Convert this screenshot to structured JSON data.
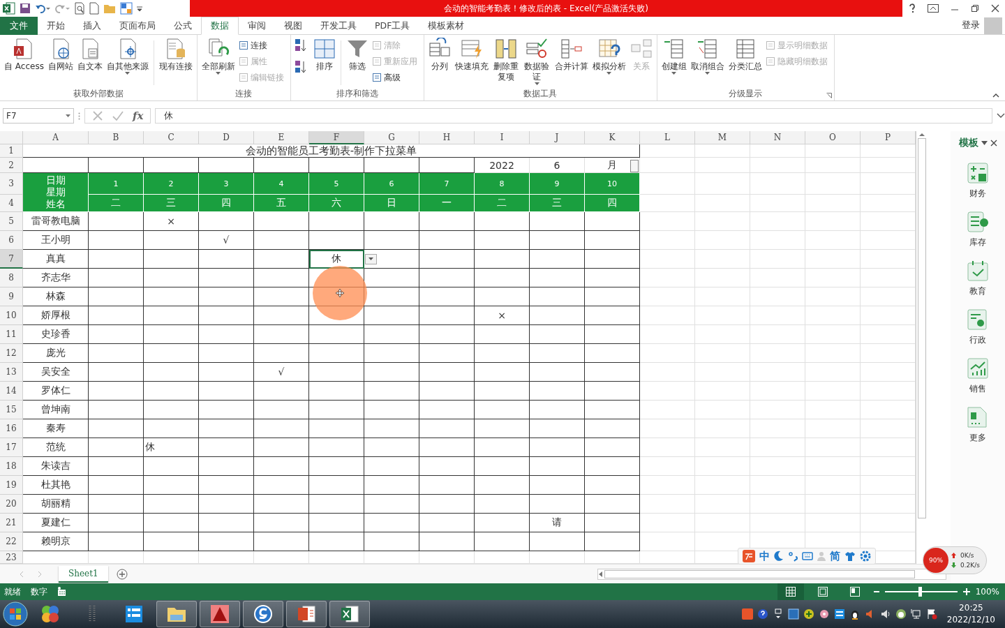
{
  "window": {
    "title": "会动的智能考勤表！修改后的表 - Excel(产品激活失败)",
    "sign_in": "登录"
  },
  "tabs": [
    {
      "label": "文件",
      "kind": "file",
      "selected": false
    },
    {
      "label": "开始",
      "kind": "tab",
      "selected": false
    },
    {
      "label": "插入",
      "kind": "tab",
      "selected": false
    },
    {
      "label": "页面布局",
      "kind": "tab",
      "selected": false
    },
    {
      "label": "公式",
      "kind": "tab",
      "selected": false
    },
    {
      "label": "数据",
      "kind": "tab",
      "selected": true
    },
    {
      "label": "审阅",
      "kind": "tab",
      "selected": false
    },
    {
      "label": "视图",
      "kind": "tab",
      "selected": false
    },
    {
      "label": "开发工具",
      "kind": "tab",
      "selected": false
    },
    {
      "label": "PDF工具",
      "kind": "tab",
      "selected": false
    },
    {
      "label": "模板素材",
      "kind": "tab",
      "selected": false
    }
  ],
  "ribbon": {
    "groups": [
      {
        "label": "获取外部数据",
        "launcher": false,
        "items": [
          {
            "kind": "large",
            "label": "自 Access",
            "dropdown": false,
            "disabled": false
          },
          {
            "kind": "large",
            "label": "自网站",
            "dropdown": false,
            "disabled": false
          },
          {
            "kind": "large",
            "label": "自文本",
            "dropdown": false,
            "disabled": false
          },
          {
            "kind": "large",
            "label": "自其他来源",
            "dropdown": true,
            "disabled": false
          },
          {
            "kind": "separator"
          },
          {
            "kind": "large",
            "label": "现有连接",
            "dropdown": false,
            "disabled": false
          }
        ]
      },
      {
        "label": "连接",
        "launcher": false,
        "items": [
          {
            "kind": "large",
            "label": "全部刷新",
            "dropdown": true,
            "disabled": false
          },
          {
            "kind": "stack",
            "buttons": [
              {
                "label": "连接",
                "disabled": false
              },
              {
                "label": "属性",
                "disabled": true
              },
              {
                "label": "编辑链接",
                "disabled": true
              }
            ]
          }
        ]
      },
      {
        "label": "排序和筛选",
        "launcher": false,
        "items": [
          {
            "kind": "sort-pair"
          },
          {
            "kind": "large",
            "label": "排序",
            "dropdown": false,
            "disabled": false
          },
          {
            "kind": "separator"
          },
          {
            "kind": "large",
            "label": "筛选",
            "dropdown": false,
            "disabled": false
          },
          {
            "kind": "stack",
            "buttons": [
              {
                "label": "清除",
                "disabled": true
              },
              {
                "label": "重新应用",
                "disabled": true
              },
              {
                "label": "高级",
                "disabled": false
              }
            ]
          }
        ]
      },
      {
        "label": "数据工具",
        "launcher": false,
        "items": [
          {
            "kind": "large",
            "label": "分列",
            "dropdown": false,
            "disabled": false
          },
          {
            "kind": "large",
            "label": "快速填充",
            "dropdown": false,
            "disabled": false
          },
          {
            "kind": "large",
            "label": "删除重复项",
            "dropdown": false,
            "disabled": false,
            "wrap": true
          },
          {
            "kind": "large",
            "label": "数据验证",
            "dropdown": true,
            "disabled": false,
            "wrap": true
          },
          {
            "kind": "large",
            "label": "合并计算",
            "dropdown": false,
            "disabled": false
          },
          {
            "kind": "large",
            "label": "模拟分析",
            "dropdown": true,
            "disabled": false
          },
          {
            "kind": "large",
            "label": "关系",
            "dropdown": false,
            "disabled": true
          }
        ]
      },
      {
        "label": "分级显示",
        "launcher": true,
        "items": [
          {
            "kind": "large",
            "label": "创建组",
            "dropdown": true,
            "disabled": false
          },
          {
            "kind": "large",
            "label": "取消组合",
            "dropdown": true,
            "disabled": false
          },
          {
            "kind": "large",
            "label": "分类汇总",
            "dropdown": false,
            "disabled": false
          },
          {
            "kind": "stack",
            "buttons": [
              {
                "label": "显示明细数据",
                "disabled": true
              },
              {
                "label": "隐藏明细数据",
                "disabled": true
              }
            ]
          }
        ]
      }
    ]
  },
  "formula_bar": {
    "name_box": "F7",
    "fx": "fx",
    "value": "休"
  },
  "sheet": {
    "columns": [
      "A",
      "B",
      "C",
      "D",
      "E",
      "F",
      "G",
      "H",
      "I",
      "J",
      "K",
      "L",
      "M",
      "N",
      "O",
      "P"
    ],
    "row_numbers": [
      "1",
      "2",
      "3",
      "4",
      "5",
      "6",
      "7",
      "8",
      "9",
      "10",
      "11",
      "12",
      "13",
      "14",
      "15",
      "16",
      "17",
      "18",
      "19",
      "20",
      "21",
      "22",
      "23"
    ],
    "title": "会动的智能员工考勤表-制作下拉菜单",
    "year": "2022",
    "month": "6",
    "month_unit": "月",
    "header_labels": [
      "日期",
      "星期",
      "姓名"
    ],
    "days": [
      {
        "day": "1",
        "weekday": "二"
      },
      {
        "day": "2",
        "weekday": "三"
      },
      {
        "day": "3",
        "weekday": "四"
      },
      {
        "day": "4",
        "weekday": "五"
      },
      {
        "day": "5",
        "weekday": "六"
      },
      {
        "day": "6",
        "weekday": "日"
      },
      {
        "day": "7",
        "weekday": "一"
      },
      {
        "day": "8",
        "weekday": "二"
      },
      {
        "day": "9",
        "weekday": "三"
      },
      {
        "day": "10",
        "weekday": "四"
      }
    ],
    "employees": [
      {
        "name": "雷哥教电脑",
        "cells": [
          null,
          {
            "text": "×",
            "selected": false,
            "left_aligned": false
          },
          null,
          null,
          null,
          null,
          null,
          null,
          null,
          null
        ]
      },
      {
        "name": "王小明",
        "cells": [
          null,
          null,
          {
            "text": "√",
            "selected": false,
            "left_aligned": false
          },
          null,
          null,
          null,
          null,
          null,
          null,
          null
        ]
      },
      {
        "name": "真真",
        "cells": [
          null,
          null,
          null,
          null,
          {
            "text": "休",
            "selected": true,
            "left_aligned": false
          },
          null,
          null,
          null,
          null,
          null
        ]
      },
      {
        "name": "齐志华",
        "cells": [
          null,
          null,
          null,
          null,
          null,
          null,
          null,
          null,
          null,
          null
        ]
      },
      {
        "name": "林森",
        "cells": [
          null,
          null,
          null,
          null,
          null,
          null,
          null,
          null,
          null,
          null
        ]
      },
      {
        "name": "娇厚根",
        "cells": [
          null,
          null,
          null,
          null,
          null,
          null,
          null,
          {
            "text": "×",
            "selected": false,
            "left_aligned": false
          },
          null,
          null
        ]
      },
      {
        "name": "史珍香",
        "cells": [
          null,
          null,
          null,
          null,
          null,
          null,
          null,
          null,
          null,
          null
        ]
      },
      {
        "name": "庞光",
        "cells": [
          null,
          null,
          null,
          null,
          null,
          null,
          null,
          null,
          null,
          null
        ]
      },
      {
        "name": "吴安全",
        "cells": [
          null,
          null,
          null,
          {
            "text": "√",
            "selected": false,
            "left_aligned": false
          },
          null,
          null,
          null,
          null,
          null,
          null
        ]
      },
      {
        "name": "罗体仁",
        "cells": [
          null,
          null,
          null,
          null,
          null,
          null,
          null,
          null,
          null,
          null
        ]
      },
      {
        "name": "曾坤南",
        "cells": [
          null,
          null,
          null,
          null,
          null,
          null,
          null,
          null,
          null,
          null
        ]
      },
      {
        "name": "秦寿",
        "cells": [
          null,
          null,
          null,
          null,
          null,
          null,
          null,
          null,
          null,
          null
        ]
      },
      {
        "name": "范统",
        "cells": [
          null,
          {
            "text": "休",
            "selected": false,
            "left_aligned": true
          },
          null,
          null,
          null,
          null,
          null,
          null,
          null,
          null
        ]
      },
      {
        "name": "朱读吉",
        "cells": [
          null,
          null,
          null,
          null,
          null,
          null,
          null,
          null,
          null,
          null
        ]
      },
      {
        "name": "杜其艳",
        "cells": [
          null,
          null,
          null,
          null,
          null,
          null,
          null,
          null,
          null,
          null
        ]
      },
      {
        "name": "胡丽精",
        "cells": [
          null,
          null,
          null,
          null,
          null,
          null,
          null,
          null,
          null,
          null
        ]
      },
      {
        "name": "夏建仁",
        "cells": [
          null,
          null,
          null,
          null,
          null,
          null,
          null,
          null,
          {
            "text": "请",
            "selected": false,
            "left_aligned": false
          },
          null
        ]
      },
      {
        "name": "赖明京",
        "cells": [
          null,
          null,
          null,
          null,
          null,
          null,
          null,
          null,
          null,
          null
        ]
      }
    ],
    "sheet_tabs": [
      {
        "label": "Sheet1",
        "selected": true
      }
    ]
  },
  "task_pane": {
    "title": "模板",
    "items": [
      {
        "label": "财务"
      },
      {
        "label": "库存"
      },
      {
        "label": "教育"
      },
      {
        "label": "行政"
      },
      {
        "label": "销售"
      },
      {
        "label": "更多"
      }
    ]
  },
  "ime_toolbar": {
    "mode": "中",
    "script": "简"
  },
  "net_monitor": {
    "usage": "90%",
    "upload": "0K/s",
    "download": "0.2K/s"
  },
  "status_bar": {
    "ready": "就绪",
    "mode": "数字",
    "views": [
      {
        "selected": true
      },
      {
        "selected": false
      },
      {
        "selected": false
      }
    ],
    "zoom": {
      "level": 0.5,
      "label": "100%"
    }
  },
  "taskbar": {
    "buttons": [
      {
        "running": false
      },
      {
        "running": false
      },
      {
        "running": false
      },
      {
        "running": true
      },
      {
        "running": true
      },
      {
        "running": true
      },
      {
        "running": true
      },
      {
        "running": true
      }
    ],
    "time": "20:25",
    "date": "2022/12/10"
  }
}
